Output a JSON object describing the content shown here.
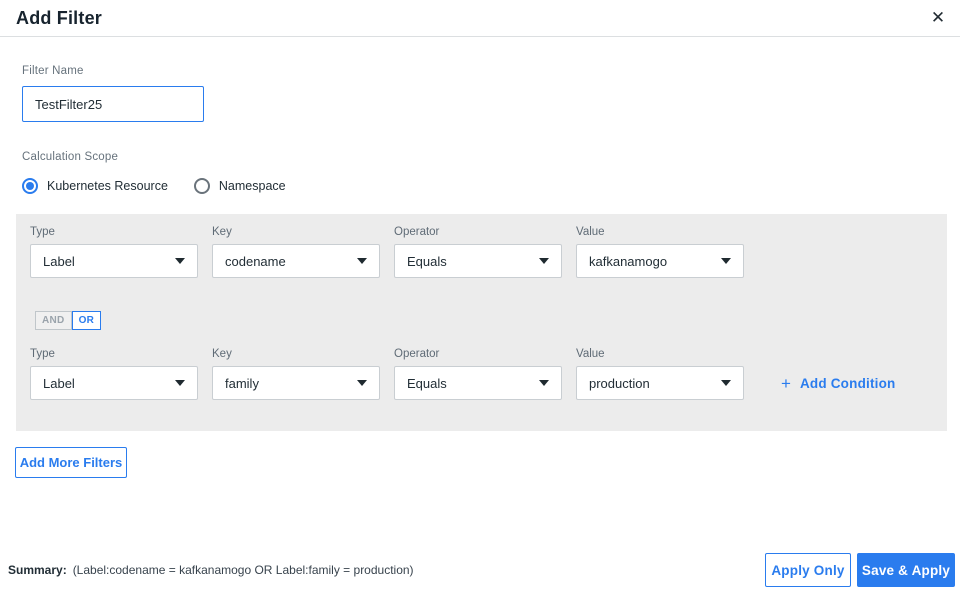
{
  "header": {
    "title": "Add Filter"
  },
  "filter_name": {
    "label": "Filter Name",
    "value": "TestFilter25"
  },
  "calculation_scope": {
    "label": "Calculation Scope",
    "options": [
      {
        "label": "Kubernetes Resource",
        "selected": true
      },
      {
        "label": "Namespace",
        "selected": false
      }
    ]
  },
  "conditions": {
    "labels": {
      "type": "Type",
      "key": "Key",
      "operator": "Operator",
      "value": "Value"
    },
    "rows": [
      {
        "type": "Label",
        "key": "codename",
        "operator": "Equals",
        "value": "kafkanamogo"
      },
      {
        "type": "Label",
        "key": "family",
        "operator": "Equals",
        "value": "production"
      }
    ],
    "logic_toggle": {
      "and_label": "AND",
      "or_label": "OR",
      "selected": "OR"
    },
    "add_condition": {
      "plus": "+",
      "label": "Add Condition"
    }
  },
  "add_more_filters_label": "Add More Filters",
  "footer": {
    "summary_label": "Summary:",
    "summary_text": "(Label:codename = kafkanamogo OR Label:family = production)",
    "apply_only_label": "Apply Only",
    "save_apply_label": "Save & Apply"
  },
  "icons": {
    "close": "✕"
  },
  "colors": {
    "accent": "#2a7cee",
    "panel_bg": "#ececec",
    "input_border": "#c9ced2"
  }
}
